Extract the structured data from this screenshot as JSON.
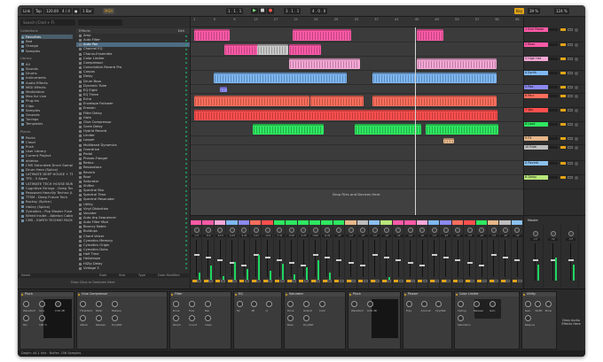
{
  "control_bar": {
    "link": "Link",
    "tap": "Tap",
    "tempo": "120.00",
    "time_sig": "4 / 4",
    "metro": "●",
    "quant": "1 Bar",
    "position": "1 . 1 . 1",
    "loop_start": "3 . 1 . 1",
    "loop_len": "4 . 0 . 0",
    "key": "Key",
    "midi": "MIDI",
    "cpu": "39 %",
    "zoom": "124 %"
  },
  "browser": {
    "search_placeholder": "Search (Cmd + F)",
    "collections_header": "Collections",
    "collections": [
      "Favorites",
      "Red",
      "Orange",
      "Samples"
    ],
    "library_header": "Library",
    "library": [
      "All",
      "Sounds",
      "Drums",
      "Instruments",
      "Audio Effects",
      "MIDI Effects",
      "Modulators",
      "Max for Live",
      "Plug-Ins",
      "Clips",
      "Samples",
      "Grooves",
      "Tunings",
      "Templates"
    ],
    "places_header": "Places",
    "places": [
      "Packs",
      "Cloud",
      "Push",
      "User Library",
      "Current Project",
      "ableton",
      "CMS Saturated Drum Sample Pack",
      "Drum Hero (Splice)",
      "ULTIMATE DEEP HOUSE + TECH",
      "TFS - 5 Alpes",
      "ULTIMATE TECH HOUSE BUNDLE + EXTRAS",
      "Cognitive Strings - Deep Tech",
      "Password Heavilly Techno (LAVR)",
      "TTSM - Deep Future Tech",
      "Rocksy (Splice)",
      "Hailey (Splice)",
      "Zymatics - Pop Master Fuse",
      "Wired Inside - Ableton Cables +",
      "CMS - EARTH TECHNO PACK"
    ],
    "files_header": "Effects",
    "files_right": "Edit",
    "files": [
      "Amp",
      "Auto Filter",
      "Auto Pan",
      "Channel EQ",
      "Chorus-Ensemble",
      "Color Limiter",
      "Compressor",
      "Convolution Reverb Pro",
      "Corpus",
      "Delay",
      "Drum Buss",
      "Dynamic Tube",
      "EQ Eight",
      "EQ Three",
      "Echo",
      "Envelope Follower",
      "Erosion",
      "Filter Delay",
      "Gate",
      "Glue Compressor",
      "Grain Delay",
      "Hybrid Reverb",
      "Limiter",
      "Looper",
      "Multiband Dynamics",
      "Overdrive",
      "Pedal",
      "Phaser-Flanger",
      "Redux",
      "Resonators",
      "Reverb",
      "Roar",
      "Saturator",
      "Shifter",
      "Spectral Blur",
      "Spectral Time",
      "Spectral Resonator",
      "Utility",
      "Vinyl Distortion",
      "Vocoder",
      "Auto Arp Sequencer",
      "Auto Filter Mod",
      "Bouncy Notes",
      "Buildups",
      "Chord Voicer",
      "Cymatics Memory",
      "Cymatics Origin",
      "Cymatics Dubs",
      "Half Time",
      "Heliotrope",
      "HiZip Delay",
      "Vintage 3"
    ],
    "bottom_cols": [
      "Name",
      "Date",
      "Size",
      "Type",
      "Date Modified"
    ],
    "drop_text": "Drop Clips or Samples Here"
  },
  "arrangement": {
    "bars": [
      "1",
      "5",
      "9",
      "13",
      "17",
      "21",
      "25",
      "29",
      "33",
      "37",
      "41",
      "45",
      "49",
      "53",
      "57",
      "61",
      "65"
    ],
    "times": [
      "0:00",
      "0:10",
      "0:20",
      "0:30",
      "0:40",
      "0:50",
      "1:00",
      "1:10",
      "1:20",
      "1:30",
      "1:40",
      "1:50"
    ],
    "drop_text": "Drop Files and Devices Here",
    "zoom": "1/4"
  },
  "tracks": [
    {
      "name": "1 Kick Power",
      "color": "#ff5aa8"
    },
    {
      "name": "2 Bass",
      "color": "#ff5aa8"
    },
    {
      "name": "3 High Hat",
      "color": "#f7a8d7"
    },
    {
      "name": "4 Synth",
      "color": "#7eb8f5"
    },
    {
      "name": "5 Pad",
      "color": "#8b89f0"
    },
    {
      "name": "6 Perc",
      "color": "#ff6e5c"
    },
    {
      "name": "7 Vox",
      "color": "#ff4f4f"
    },
    {
      "name": "8 Lead",
      "color": "#2ee860"
    },
    {
      "name": "9 FX",
      "color": "#e6b68a"
    },
    {
      "name": "10 Ride",
      "color": "#bdbdbd"
    },
    {
      "name": "A Reverb",
      "color": "#8bc0ef"
    },
    {
      "name": "B Delay",
      "color": "#b8e77a"
    }
  ],
  "mixer": {
    "strip_values": [
      "-inf",
      "-8.6",
      "-12.9",
      "-9.43",
      "-5.41",
      "-3.21",
      "-14.6",
      "-7.21",
      "-9.03",
      "-2.23",
      "-5.60",
      "-6.34",
      "-inf",
      "-inf",
      "-inf",
      "-inf",
      "-inf",
      "-inf",
      "-inf",
      "-inf",
      "-inf",
      "-inf",
      "-inf",
      "-inf",
      "-inf",
      "-inf",
      "-inf",
      "-inf"
    ],
    "master_label": "Master",
    "master_values": [
      "-inf",
      "-12",
      "-inf"
    ]
  },
  "devices": [
    {
      "name": "Pluck",
      "params": [
        "Waveform",
        "Sine",
        "0.00 dB",
        "Mix",
        "100 %"
      ]
    },
    {
      "name": "Glue Compressor",
      "params": [
        "Threshold",
        "Ratio",
        "Makeup",
        "Attack",
        "Release",
        "Dry/Wet"
      ]
    },
    {
      "name": "Filter",
      "params": [
        "Drive",
        "Freq",
        "Res",
        "Morph",
        "Circuit",
        "Clean"
      ]
    },
    {
      "name": "EQ",
      "params": [
        "Hz",
        "dB",
        "Q"
      ]
    },
    {
      "name": "Saturator",
      "params": [
        "Drive",
        "Output",
        "Color",
        "Base",
        "Dry/Wet"
      ]
    },
    {
      "name": "Pluck",
      "params": [
        "Waveform",
        "0.00 dB"
      ]
    },
    {
      "name": "Phaser",
      "params": [
        "Freq",
        "Amount",
        "Dry/Wet"
      ]
    },
    {
      "name": "Color Limiter",
      "params": [
        "Ceiling",
        "Release",
        "Gain",
        "Saturation"
      ]
    },
    {
      "name": "Utility",
      "params": [
        "Gain",
        "Width",
        "Mono",
        "Balance"
      ]
    }
  ],
  "device_drop": "Drop Audio Effects Here",
  "status": "Depth: 44.1 kHz · Buffer: 256 Samples",
  "colors": {
    "accent": "#e2a418",
    "meter": "#1ed760",
    "window": "#2b2b2b"
  }
}
